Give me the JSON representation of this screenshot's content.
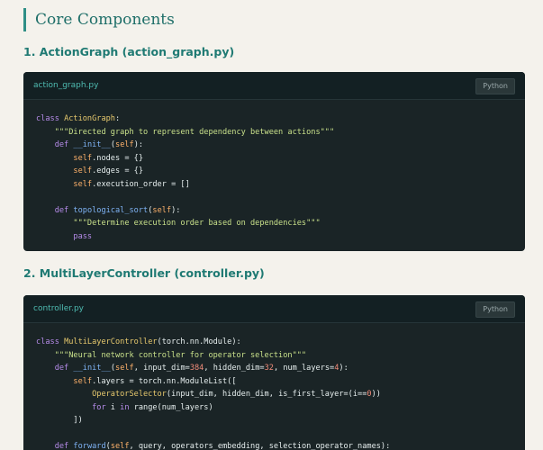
{
  "section": {
    "title": "Core Components"
  },
  "components": [
    {
      "heading": "1. ActionGraph (action_graph.py)",
      "filename": "action_graph.py",
      "language": "Python",
      "code": {
        "l1_kw": "class",
        "l1_name": "ActionGraph",
        "l1_end": ":",
        "l2_doc": "\"\"\"Directed graph to represent dependency between actions\"\"\"",
        "l3_kw": "def",
        "l3_fn": "__init__",
        "l3_open": "(",
        "l3_self": "self",
        "l3_close": "):",
        "l4_self": "self",
        "l4_rest": ".nodes = {}",
        "l5_self": "self",
        "l5_rest": ".edges = {}",
        "l6_self": "self",
        "l6_rest": ".execution_order = []",
        "l8_kw": "def",
        "l8_fn": "topological_sort",
        "l8_open": "(",
        "l8_self": "self",
        "l8_close": "):",
        "l9_doc": "\"\"\"Determine execution order based on dependencies\"\"\"",
        "l10_kw": "pass"
      }
    },
    {
      "heading": "2. MultiLayerController (controller.py)",
      "filename": "controller.py",
      "language": "Python",
      "code": {
        "l1_kw": "class",
        "l1_name": "MultiLayerController",
        "l1_end": "(torch.nn.Module):",
        "l2_doc": "\"\"\"Neural network controller for operator selection\"\"\"",
        "l3_kw": "def",
        "l3_fn": "__init__",
        "l3_open": "(",
        "l3_self": "self",
        "l3_mid": ", input_dim=",
        "l3_n1": "384",
        "l3_mid2": ", hidden_dim=",
        "l3_n2": "32",
        "l3_mid3": ", num_layers=",
        "l3_n3": "4",
        "l3_close": "):",
        "l4_self": "self",
        "l4_rest": ".layers = torch.nn.ModuleList([",
        "l5_cls": "OperatorSelector",
        "l5_rest": "(input_dim, hidden_dim, is_first_layer=(i==",
        "l5_n": "0",
        "l5_end": "))",
        "l6_kw1": "for",
        "l6_mid": " i ",
        "l6_kw2": "in",
        "l6_rest": " range(num_layers)",
        "l7": "])",
        "l9_kw": "def",
        "l9_fn": "forward",
        "l9_open": "(",
        "l9_self": "self",
        "l9_rest": ", query, operators_embedding, selection_operator_names):"
      }
    }
  ]
}
